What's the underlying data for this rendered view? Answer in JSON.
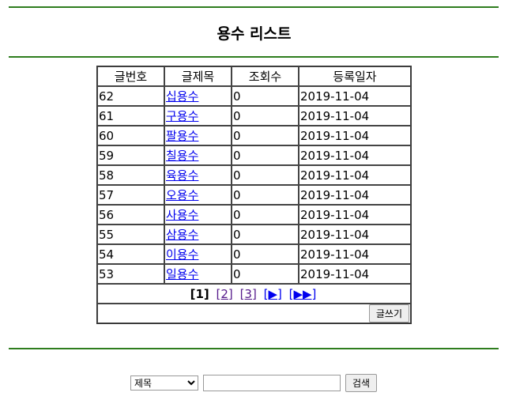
{
  "page": {
    "title": "용수 리스트"
  },
  "table": {
    "headers": [
      "글번호",
      "글제목",
      "조회수",
      "등록일자"
    ],
    "rows": [
      {
        "num": "62",
        "title": "십용수",
        "views": "0",
        "date": "2019-11-04"
      },
      {
        "num": "61",
        "title": "구용수",
        "views": "0",
        "date": "2019-11-04"
      },
      {
        "num": "60",
        "title": "팔용수",
        "views": "0",
        "date": "2019-11-04"
      },
      {
        "num": "59",
        "title": "칠용수",
        "views": "0",
        "date": "2019-11-04"
      },
      {
        "num": "58",
        "title": "육용수",
        "views": "0",
        "date": "2019-11-04"
      },
      {
        "num": "57",
        "title": "오용수",
        "views": "0",
        "date": "2019-11-04"
      },
      {
        "num": "56",
        "title": "사용수",
        "views": "0",
        "date": "2019-11-04"
      },
      {
        "num": "55",
        "title": "삼용수",
        "views": "0",
        "date": "2019-11-04"
      },
      {
        "num": "54",
        "title": "이용수",
        "views": "0",
        "date": "2019-11-04"
      },
      {
        "num": "53",
        "title": "일용수",
        "views": "0",
        "date": "2019-11-04"
      }
    ]
  },
  "pagination": {
    "current": "[1]",
    "page2": "[2]",
    "page3": "[3]",
    "next": "[▶]",
    "last": "[▶▶]"
  },
  "actions": {
    "write_label": "글쓰기"
  },
  "search": {
    "field_selected": "제목",
    "query": "",
    "button_label": "검색"
  },
  "colors": {
    "rule": "#2e7d1e",
    "link": "#0000ee",
    "visited_link": "#551a8b"
  }
}
